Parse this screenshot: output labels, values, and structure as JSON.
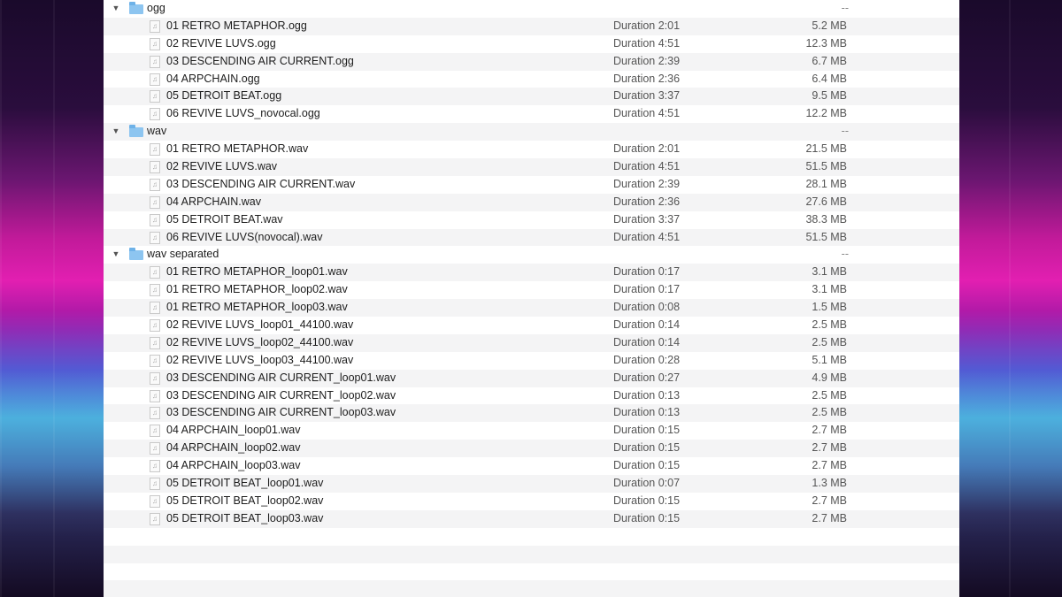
{
  "icons": {
    "folder": "folder-icon",
    "audio_file": "audio-file-icon",
    "disclosure": "disclosure-triangle-icon"
  },
  "colors": {
    "folder": "#8dc5f0",
    "row_alt": "#f4f4f5"
  },
  "rows": [
    {
      "kind": "folder",
      "name": "ogg",
      "size": "--"
    },
    {
      "kind": "file",
      "name": "01 RETRO METAPHOR.ogg",
      "duration": "Duration 2:01",
      "size": "5.2 MB"
    },
    {
      "kind": "file",
      "name": "02 REVIVE LUVS.ogg",
      "duration": "Duration 4:51",
      "size": "12.3 MB"
    },
    {
      "kind": "file",
      "name": "03 DESCENDING AIR CURRENT.ogg",
      "duration": "Duration 2:39",
      "size": "6.7 MB"
    },
    {
      "kind": "file",
      "name": "04 ARPCHAIN.ogg",
      "duration": "Duration 2:36",
      "size": "6.4 MB"
    },
    {
      "kind": "file",
      "name": "05 DETROIT BEAT.ogg",
      "duration": "Duration 3:37",
      "size": "9.5 MB"
    },
    {
      "kind": "file",
      "name": "06 REVIVE LUVS_novocal.ogg",
      "duration": "Duration 4:51",
      "size": "12.2 MB"
    },
    {
      "kind": "folder",
      "name": "wav",
      "size": "--"
    },
    {
      "kind": "file",
      "name": "01 RETRO METAPHOR.wav",
      "duration": "Duration 2:01",
      "size": "21.5 MB"
    },
    {
      "kind": "file",
      "name": "02 REVIVE LUVS.wav",
      "duration": "Duration 4:51",
      "size": "51.5 MB"
    },
    {
      "kind": "file",
      "name": "03 DESCENDING AIR CURRENT.wav",
      "duration": "Duration 2:39",
      "size": "28.1 MB"
    },
    {
      "kind": "file",
      "name": "04 ARPCHAIN.wav",
      "duration": "Duration 2:36",
      "size": "27.6 MB"
    },
    {
      "kind": "file",
      "name": "05 DETROIT BEAT.wav",
      "duration": "Duration 3:37",
      "size": "38.3 MB"
    },
    {
      "kind": "file",
      "name": "06 REVIVE LUVS(novocal).wav",
      "duration": "Duration 4:51",
      "size": "51.5 MB"
    },
    {
      "kind": "folder",
      "name": "wav separated",
      "size": "--"
    },
    {
      "kind": "file",
      "name": "01 RETRO METAPHOR_loop01.wav",
      "duration": "Duration 0:17",
      "size": "3.1 MB"
    },
    {
      "kind": "file",
      "name": "01 RETRO METAPHOR_loop02.wav",
      "duration": "Duration 0:17",
      "size": "3.1 MB"
    },
    {
      "kind": "file",
      "name": "01 RETRO METAPHOR_loop03.wav",
      "duration": "Duration 0:08",
      "size": "1.5 MB"
    },
    {
      "kind": "file",
      "name": "02 REVIVE LUVS_loop01_44100.wav",
      "duration": "Duration 0:14",
      "size": "2.5 MB"
    },
    {
      "kind": "file",
      "name": "02 REVIVE LUVS_loop02_44100.wav",
      "duration": "Duration 0:14",
      "size": "2.5 MB"
    },
    {
      "kind": "file",
      "name": "02 REVIVE LUVS_loop03_44100.wav",
      "duration": "Duration 0:28",
      "size": "5.1 MB"
    },
    {
      "kind": "file",
      "name": "03 DESCENDING AIR CURRENT_loop01.wav",
      "duration": "Duration 0:27",
      "size": "4.9 MB"
    },
    {
      "kind": "file",
      "name": "03 DESCENDING AIR CURRENT_loop02.wav",
      "duration": "Duration 0:13",
      "size": "2.5 MB"
    },
    {
      "kind": "file",
      "name": "03 DESCENDING AIR CURRENT_loop03.wav",
      "duration": "Duration 0:13",
      "size": "2.5 MB"
    },
    {
      "kind": "file",
      "name": "04 ARPCHAIN_loop01.wav",
      "duration": "Duration 0:15",
      "size": "2.7 MB"
    },
    {
      "kind": "file",
      "name": "04 ARPCHAIN_loop02.wav",
      "duration": "Duration 0:15",
      "size": "2.7 MB"
    },
    {
      "kind": "file",
      "name": "04 ARPCHAIN_loop03.wav",
      "duration": "Duration 0:15",
      "size": "2.7 MB"
    },
    {
      "kind": "file",
      "name": "05 DETROIT BEAT_loop01.wav",
      "duration": "Duration 0:07",
      "size": "1.3 MB"
    },
    {
      "kind": "file",
      "name": "05 DETROIT BEAT_loop02.wav",
      "duration": "Duration 0:15",
      "size": "2.7 MB"
    },
    {
      "kind": "file",
      "name": "05 DETROIT BEAT_loop03.wav",
      "duration": "Duration 0:15",
      "size": "2.7 MB"
    }
  ]
}
